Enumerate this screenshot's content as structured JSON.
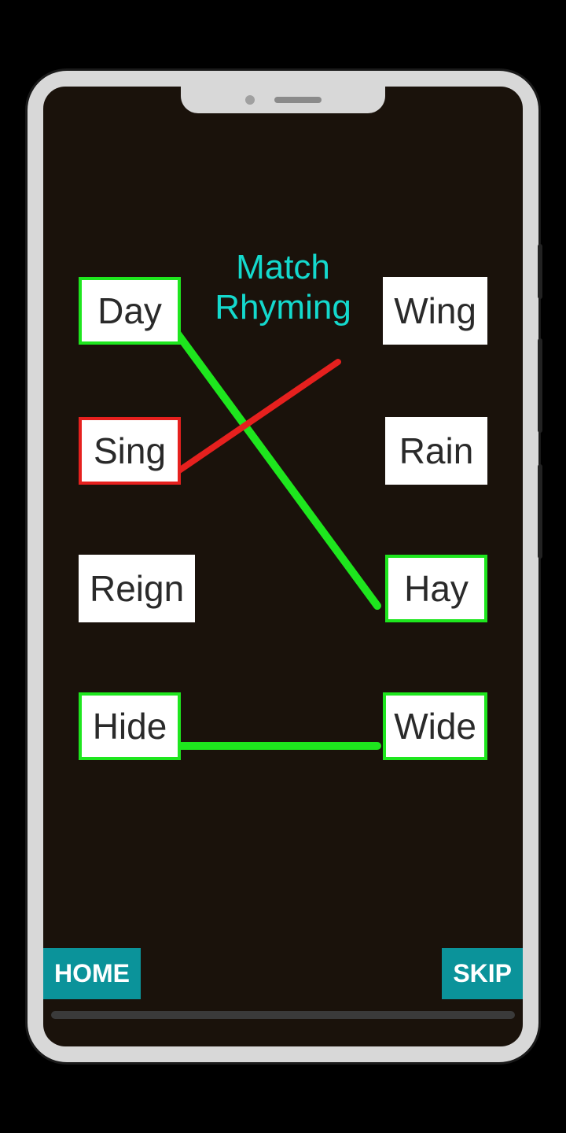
{
  "title": "Match\nRhyming",
  "colors": {
    "correct": "#1ee61e",
    "incorrect": "#e6201e",
    "neutral": "#ffffff",
    "accent": "#14d9cd",
    "button": "#0b939a"
  },
  "leftWords": [
    {
      "label": "Day",
      "state": "correct"
    },
    {
      "label": "Sing",
      "state": "incorrect"
    },
    {
      "label": "Reign",
      "state": "neutral"
    },
    {
      "label": "Hide",
      "state": "correct"
    }
  ],
  "rightWords": [
    {
      "label": "Wing",
      "state": "neutral"
    },
    {
      "label": "Rain",
      "state": "neutral"
    },
    {
      "label": "Hay",
      "state": "correct"
    },
    {
      "label": "Wide",
      "state": "correct"
    }
  ],
  "connections": [
    {
      "fromSide": "left",
      "fromIndex": 0,
      "toSide": "right",
      "toIndex": 2,
      "state": "correct"
    },
    {
      "fromSide": "left",
      "fromIndex": 1,
      "toSide": "right",
      "toIndex": 0,
      "state": "incorrect",
      "partial": true
    },
    {
      "fromSide": "left",
      "fromIndex": 3,
      "toSide": "right",
      "toIndex": 3,
      "state": "correct"
    }
  ],
  "buttons": {
    "home": "HOME",
    "skip": "SKIP"
  }
}
